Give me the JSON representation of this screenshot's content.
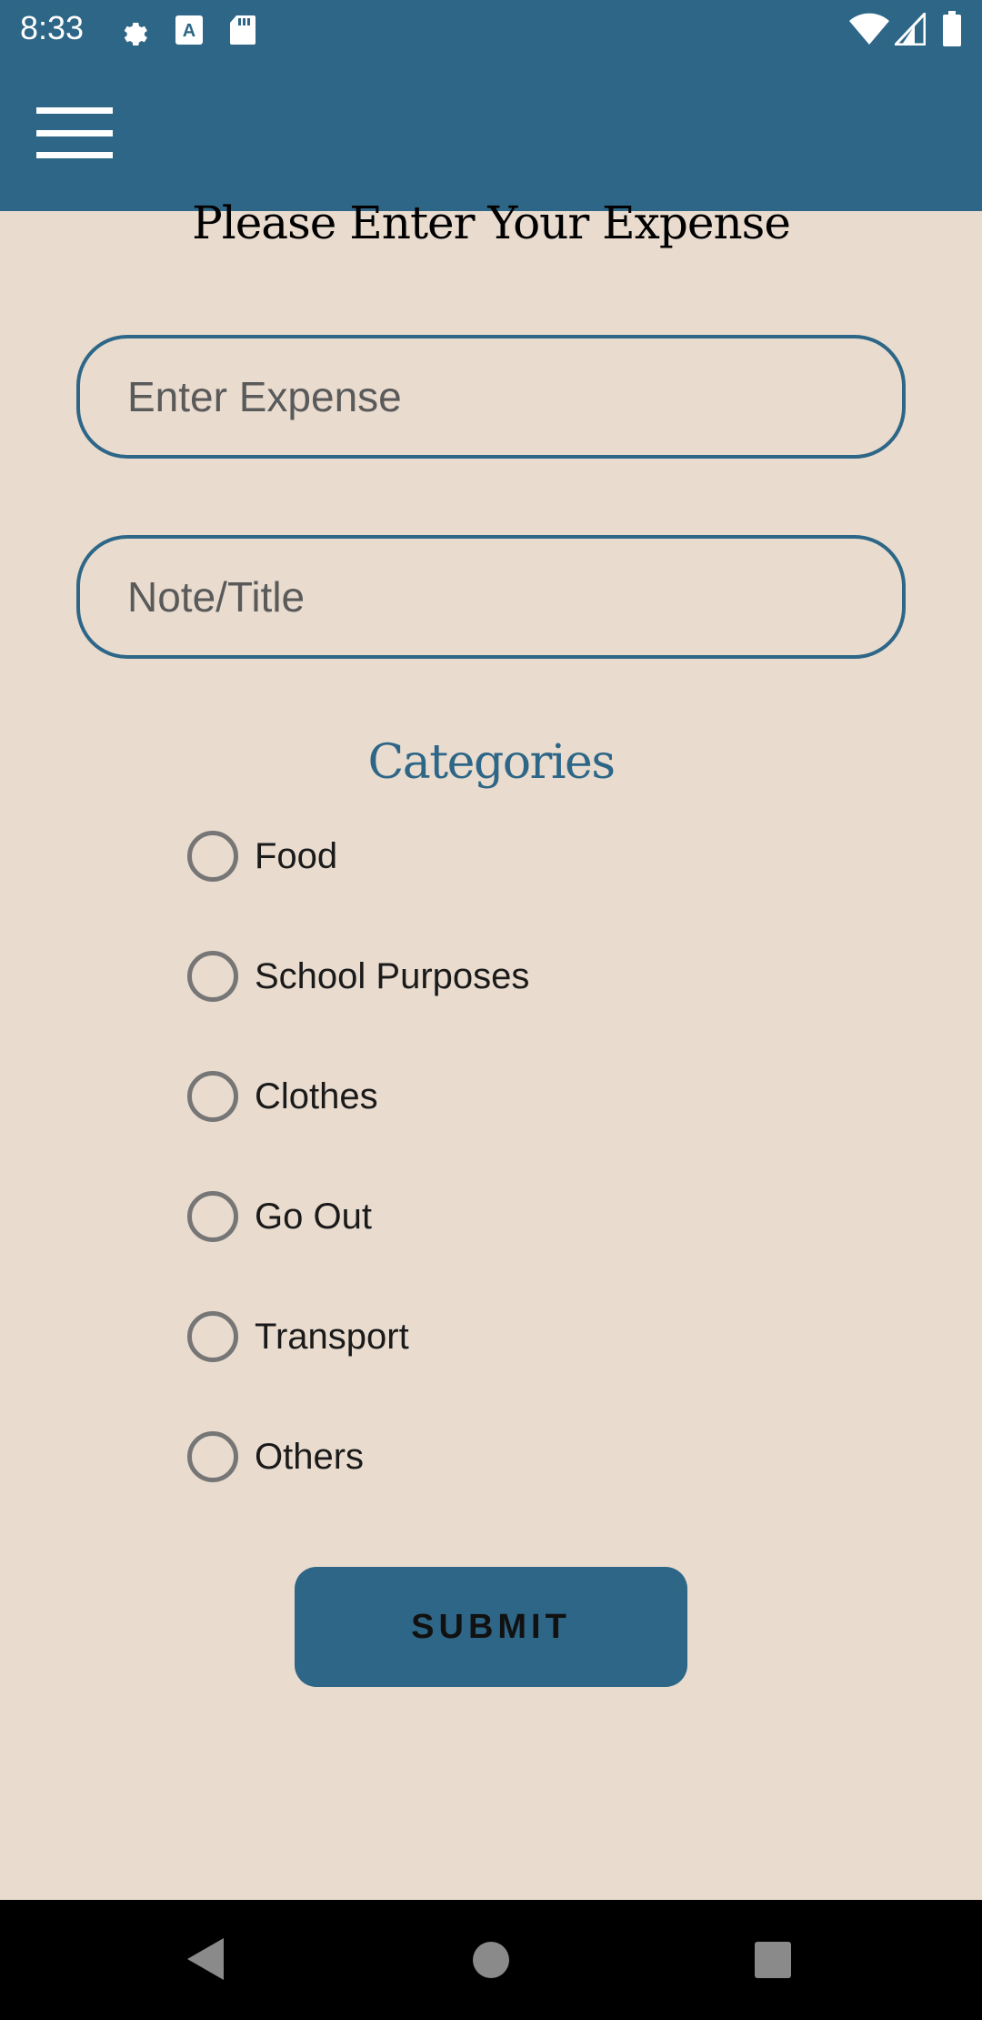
{
  "status_bar": {
    "time": "8:33",
    "icons": [
      "gear-icon",
      "a-icon",
      "sd-card-icon",
      "wifi-icon",
      "signal-icon",
      "battery-icon"
    ]
  },
  "app_bar": {
    "menu_icon": "menu-icon",
    "background_color": "#2d6687"
  },
  "form": {
    "title": "Please Enter Your Expense",
    "expense_input": {
      "placeholder": "Enter Expense",
      "value": ""
    },
    "note_input": {
      "placeholder": "Note/Title",
      "value": ""
    }
  },
  "categories": {
    "title": "Categories",
    "options": [
      {
        "label": "Food",
        "selected": false
      },
      {
        "label": "School Purposes",
        "selected": false
      },
      {
        "label": "Clothes",
        "selected": false
      },
      {
        "label": "Go Out",
        "selected": false
      },
      {
        "label": "Transport",
        "selected": false
      },
      {
        "label": "Others",
        "selected": false
      }
    ]
  },
  "submit_label": "SUBMIT",
  "nav_bar": {
    "icons": [
      "back-icon",
      "home-icon",
      "recents-icon"
    ]
  },
  "colors": {
    "accent": "#2d6687",
    "background": "#e9dccf"
  }
}
